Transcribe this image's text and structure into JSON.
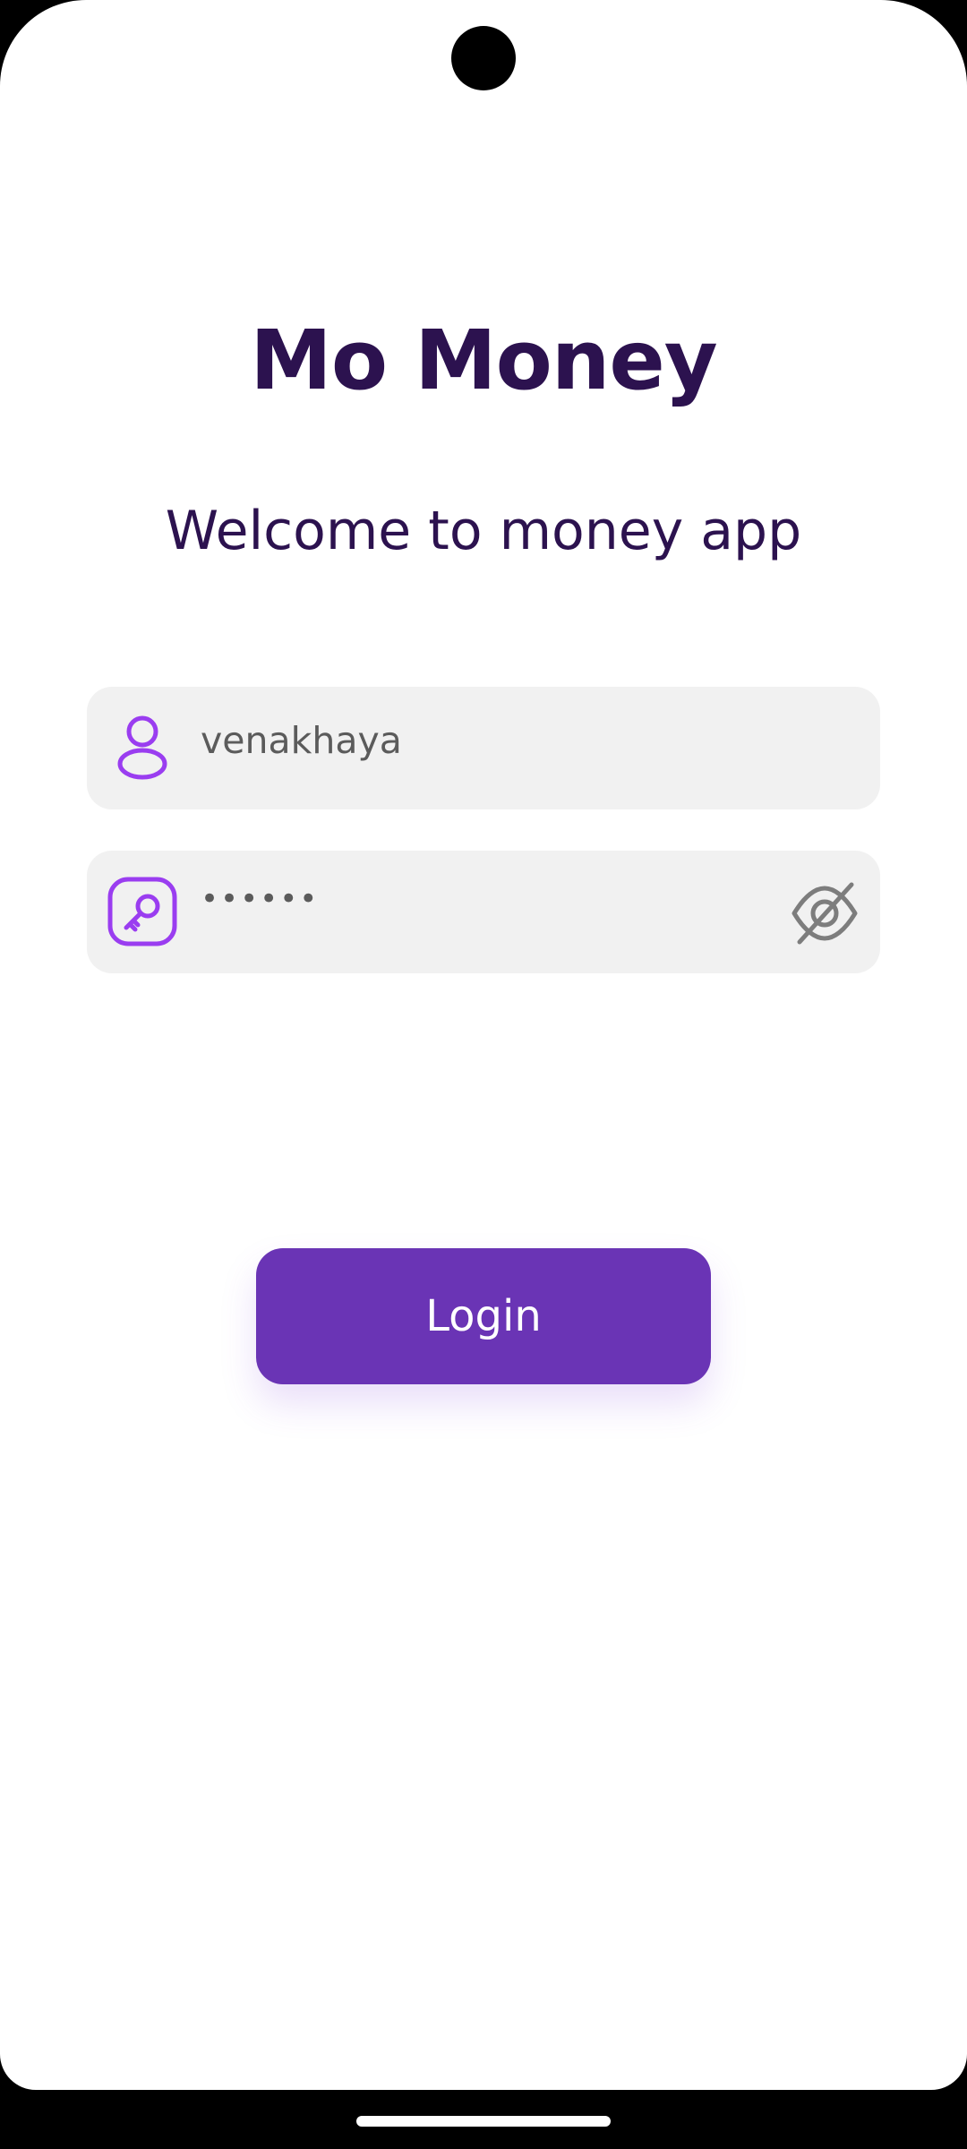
{
  "app": {
    "title": "Mo Money",
    "subtitle": "Welcome to money app"
  },
  "form": {
    "username": {
      "value": "venakhaya",
      "icon": "person-icon"
    },
    "password": {
      "value": "••••••",
      "icon": "key-icon",
      "toggle_icon": "eye-off-icon"
    },
    "login_label": "Login"
  },
  "colors": {
    "title": "#2c124f",
    "accent": "#9a3df0",
    "button": "#6a34b5",
    "field_bg": "#f1f1f1"
  }
}
